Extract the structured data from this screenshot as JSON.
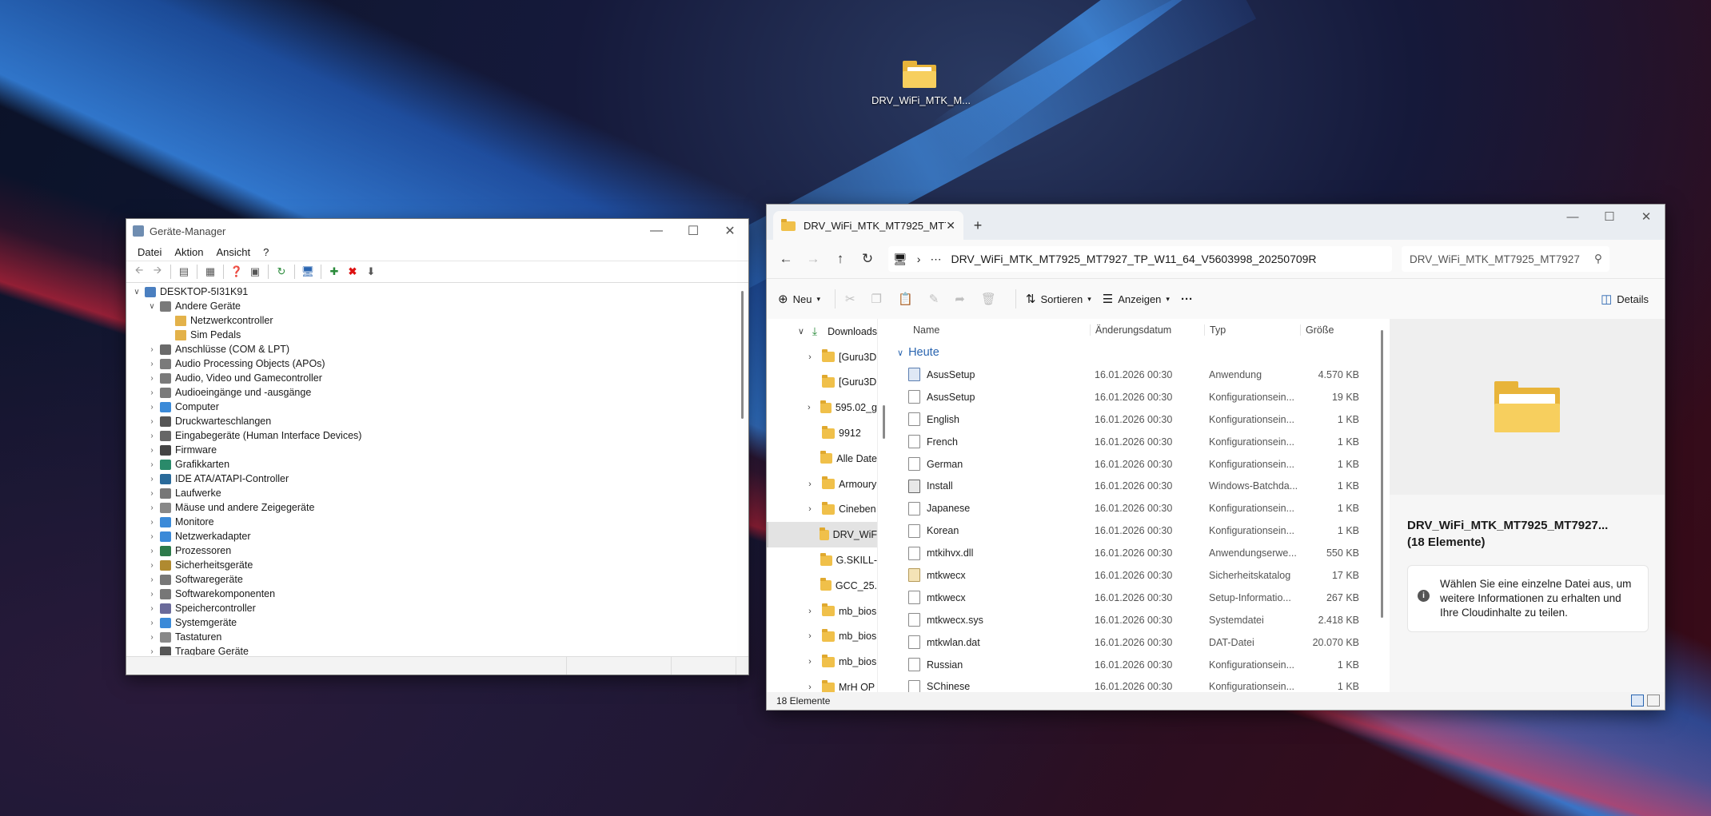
{
  "desktop": {
    "icon_label": "DRV_WiFi_MTK_M..."
  },
  "device_manager": {
    "title": "Geräte-Manager",
    "menu": [
      "Datei",
      "Aktion",
      "Ansicht",
      "?"
    ],
    "tree": [
      {
        "label": "DESKTOP-5I31K91",
        "level": 0,
        "expanded": true,
        "icon": "computer-icon"
      },
      {
        "label": "Andere Geräte",
        "level": 1,
        "expanded": true,
        "icon": "unknown-device-icon"
      },
      {
        "label": "Netzwerkcontroller",
        "level": 2,
        "icon": "warning-device-icon"
      },
      {
        "label": "Sim Pedals",
        "level": 2,
        "icon": "warning-device-icon"
      },
      {
        "label": "Anschlüsse (COM & LPT)",
        "level": 1,
        "icon": "port-icon"
      },
      {
        "label": "Audio Processing Objects (APOs)",
        "level": 1,
        "icon": "speaker-icon"
      },
      {
        "label": "Audio, Video und Gamecontroller",
        "level": 1,
        "icon": "speaker-icon"
      },
      {
        "label": "Audioeingänge und -ausgänge",
        "level": 1,
        "icon": "speaker-icon"
      },
      {
        "label": "Computer",
        "level": 1,
        "icon": "monitor-icon"
      },
      {
        "label": "Druckwarteschlangen",
        "level": 1,
        "icon": "printer-icon"
      },
      {
        "label": "Eingabegeräte (Human Interface Devices)",
        "level": 1,
        "icon": "hid-icon"
      },
      {
        "label": "Firmware",
        "level": 1,
        "icon": "firmware-icon"
      },
      {
        "label": "Grafikkarten",
        "level": 1,
        "icon": "gpu-icon"
      },
      {
        "label": "IDE ATA/ATAPI-Controller",
        "level": 1,
        "icon": "ide-icon"
      },
      {
        "label": "Laufwerke",
        "level": 1,
        "icon": "drive-icon"
      },
      {
        "label": "Mäuse und andere Zeigegeräte",
        "level": 1,
        "icon": "mouse-icon"
      },
      {
        "label": "Monitore",
        "level": 1,
        "icon": "monitor-icon"
      },
      {
        "label": "Netzwerkadapter",
        "level": 1,
        "icon": "network-icon"
      },
      {
        "label": "Prozessoren",
        "level": 1,
        "icon": "cpu-icon"
      },
      {
        "label": "Sicherheitsgeräte",
        "level": 1,
        "icon": "security-icon"
      },
      {
        "label": "Softwaregeräte",
        "level": 1,
        "icon": "software-icon"
      },
      {
        "label": "Softwarekomponenten",
        "level": 1,
        "icon": "software-icon"
      },
      {
        "label": "Speichercontroller",
        "level": 1,
        "icon": "storage-icon"
      },
      {
        "label": "Systemgeräte",
        "level": 1,
        "icon": "system-icon"
      },
      {
        "label": "Tastaturen",
        "level": 1,
        "icon": "keyboard-icon"
      },
      {
        "label": "Tragbare Geräte",
        "level": 1,
        "icon": "portable-icon"
      }
    ]
  },
  "explorer": {
    "tab_title": "DRV_WiFi_MTK_MT7925_MT7",
    "address": "DRV_WiFi_MTK_MT7925_MT7927_TP_W11_64_V5603998_20250709R",
    "search_placeholder": "DRV_WiFi_MTK_MT7925_MT7927",
    "commands": {
      "new": "Neu",
      "sort": "Sortieren",
      "view": "Anzeigen",
      "more": "···",
      "details": "Details"
    },
    "nav_pane": [
      {
        "label": "Downloads",
        "chevron": "down",
        "indent": 1,
        "icon": "download-icon"
      },
      {
        "label": "[Guru3D",
        "chevron": "right",
        "indent": 2
      },
      {
        "label": "[Guru3D",
        "chevron": "",
        "indent": 2
      },
      {
        "label": "595.02_g",
        "chevron": "right",
        "indent": 2
      },
      {
        "label": "9912",
        "chevron": "",
        "indent": 2
      },
      {
        "label": "Alle Date",
        "chevron": "",
        "indent": 2
      },
      {
        "label": "Armoury",
        "chevron": "right",
        "indent": 2
      },
      {
        "label": "Cineben",
        "chevron": "right",
        "indent": 2
      },
      {
        "label": "DRV_WiF",
        "chevron": "",
        "indent": 2,
        "selected": true
      },
      {
        "label": "G.SKILL-",
        "chevron": "",
        "indent": 2
      },
      {
        "label": "GCC_25.",
        "chevron": "",
        "indent": 2
      },
      {
        "label": "mb_bios",
        "chevron": "right",
        "indent": 2
      },
      {
        "label": "mb_bios",
        "chevron": "right",
        "indent": 2
      },
      {
        "label": "mb_bios",
        "chevron": "right",
        "indent": 2
      },
      {
        "label": "MrH OP",
        "chevron": "right",
        "indent": 2
      }
    ],
    "columns": {
      "name": "Name",
      "date": "Änderungsdatum",
      "type": "Typ",
      "size": "Größe"
    },
    "group": "Heute",
    "files": [
      {
        "name": "AsusSetup",
        "date": "16.01.2026 00:30",
        "type": "Anwendung",
        "size": "4.570 KB",
        "icon": "exe"
      },
      {
        "name": "AsusSetup",
        "date": "16.01.2026 00:30",
        "type": "Konfigurationsein...",
        "size": "19 KB",
        "icon": "ini"
      },
      {
        "name": "English",
        "date": "16.01.2026 00:30",
        "type": "Konfigurationsein...",
        "size": "1 KB",
        "icon": "ini"
      },
      {
        "name": "French",
        "date": "16.01.2026 00:30",
        "type": "Konfigurationsein...",
        "size": "1 KB",
        "icon": "ini"
      },
      {
        "name": "German",
        "date": "16.01.2026 00:30",
        "type": "Konfigurationsein...",
        "size": "1 KB",
        "icon": "ini"
      },
      {
        "name": "Install",
        "date": "16.01.2026 00:30",
        "type": "Windows-Batchda...",
        "size": "1 KB",
        "icon": "bat"
      },
      {
        "name": "Japanese",
        "date": "16.01.2026 00:30",
        "type": "Konfigurationsein...",
        "size": "1 KB",
        "icon": "ini"
      },
      {
        "name": "Korean",
        "date": "16.01.2026 00:30",
        "type": "Konfigurationsein...",
        "size": "1 KB",
        "icon": "ini"
      },
      {
        "name": "mtkihvx.dll",
        "date": "16.01.2026 00:30",
        "type": "Anwendungserwe...",
        "size": "550 KB",
        "icon": "dll"
      },
      {
        "name": "mtkwecx",
        "date": "16.01.2026 00:30",
        "type": "Sicherheitskatalog",
        "size": "17 KB",
        "icon": "cat"
      },
      {
        "name": "mtkwecx",
        "date": "16.01.2026 00:30",
        "type": "Setup-Informatio...",
        "size": "267 KB",
        "icon": "inf"
      },
      {
        "name": "mtkwecx.sys",
        "date": "16.01.2026 00:30",
        "type": "Systemdatei",
        "size": "2.418 KB",
        "icon": "sys"
      },
      {
        "name": "mtkwlan.dat",
        "date": "16.01.2026 00:30",
        "type": "DAT-Datei",
        "size": "20.070 KB",
        "icon": "dat"
      },
      {
        "name": "Russian",
        "date": "16.01.2026 00:30",
        "type": "Konfigurationsein...",
        "size": "1 KB",
        "icon": "ini"
      },
      {
        "name": "SChinese",
        "date": "16.01.2026 00:30",
        "type": "Konfigurationsein...",
        "size": "1 KB",
        "icon": "ini"
      }
    ],
    "details_pane": {
      "name": "DRV_WiFi_MTK_MT7925_MT7927...",
      "count": "(18 Elemente)",
      "info": "Wählen Sie eine einzelne Datei aus, um weitere Informationen zu erhalten und Ihre Cloudinhalte zu teilen."
    },
    "status": "18 Elemente"
  }
}
